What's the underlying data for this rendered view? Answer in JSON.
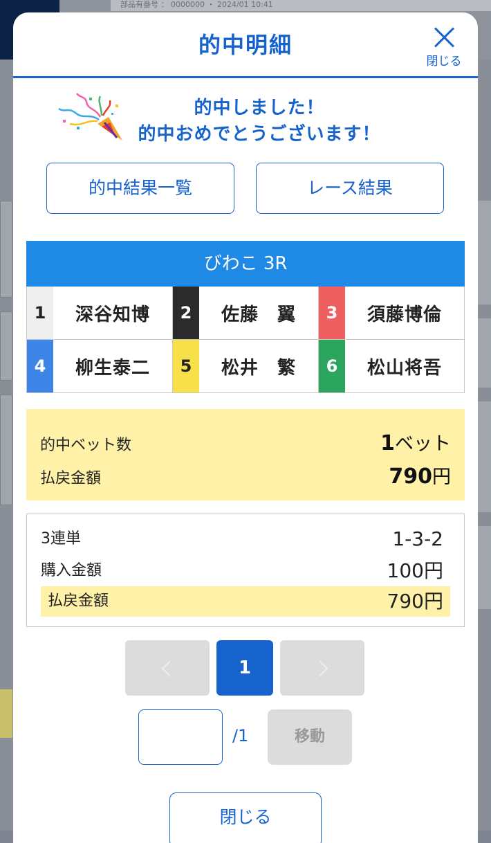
{
  "colors": {
    "brand_blue": "#1763cd",
    "race_header": "#1e8ae6",
    "highlight": "#fff2a8"
  },
  "background": {
    "title_fragment": "部品有番号 ： 0000000 ・ 2024/01 10:41"
  },
  "modal": {
    "title": "的中明細",
    "close_label": "閉じる",
    "close_icon": "close-icon"
  },
  "congrats": {
    "icon": "party-popper-icon",
    "line1": "的中しました！",
    "line2": "的中おめでとうございます！"
  },
  "buttons": {
    "hit_results": "的中結果一覧",
    "race_results": "レース結果"
  },
  "race": {
    "title": "びわこ 3R",
    "racers": [
      {
        "num": "1",
        "name": "深谷知博",
        "bg": "#efefef",
        "fg": "#222222"
      },
      {
        "num": "2",
        "name": "佐藤　翼",
        "bg": "#2b2b2b",
        "fg": "#ffffff"
      },
      {
        "num": "3",
        "name": "須藤博倫",
        "bg": "#ee5f5f",
        "fg": "#ffffff"
      },
      {
        "num": "4",
        "name": "柳生泰二",
        "bg": "#3d86e8",
        "fg": "#ffffff"
      },
      {
        "num": "5",
        "name": "松井　繁",
        "bg": "#f7e04a",
        "fg": "#222222"
      },
      {
        "num": "6",
        "name": "松山将吾",
        "bg": "#2ba55e",
        "fg": "#ffffff"
      }
    ]
  },
  "summary": {
    "bet_count_label": "的中ベット数",
    "bet_count_value": "1",
    "bet_count_unit": "ベット",
    "payout_label": "払戻金額",
    "payout_value": "790",
    "payout_unit": "円"
  },
  "detail": {
    "bet_type_label": "3連単",
    "bet_type_value": "1-3-2",
    "purchase_label": "購入金額",
    "purchase_value": "100円",
    "payout_label": "払戻金額",
    "payout_value": "790円"
  },
  "pagination": {
    "current": "1",
    "total_label": "/1",
    "move_label": "移動",
    "input_value": ""
  },
  "footer": {
    "close_label": "閉じる"
  }
}
